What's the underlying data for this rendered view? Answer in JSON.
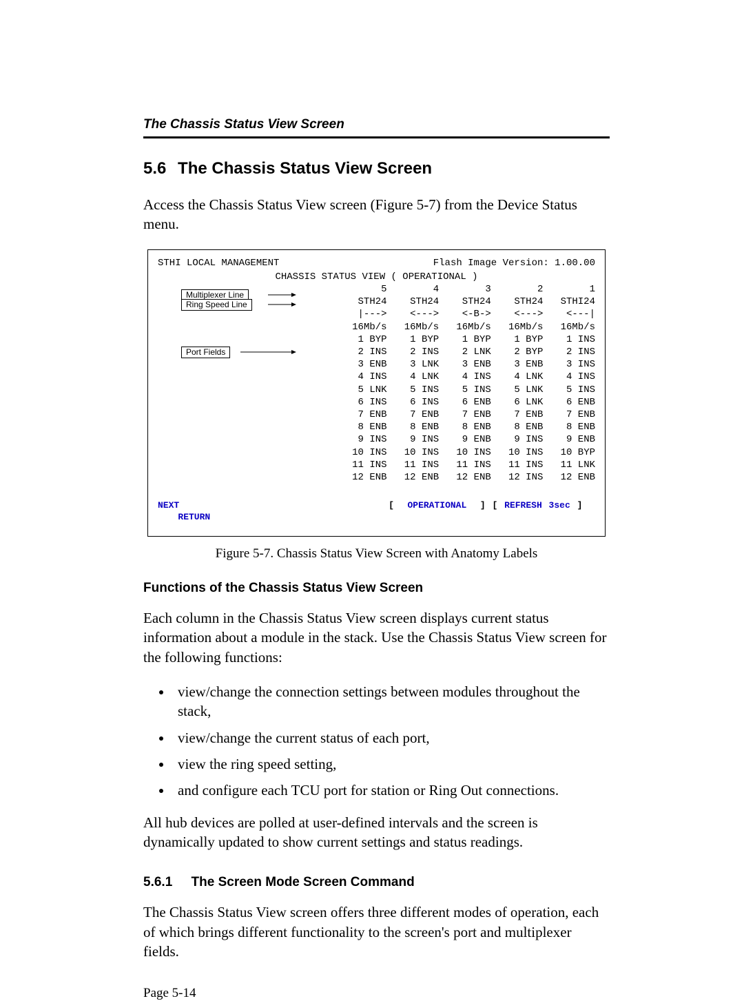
{
  "running_head": "The Chassis Status View Screen",
  "section_num": "5.6",
  "section_title": "The Chassis Status View Screen",
  "intro_para": "Access the Chassis Status View screen (Figure 5-7) from the Device Status menu.",
  "terminal": {
    "header_left": "STHI LOCAL MANAGEMENT",
    "header_right": "Flash Image Version:  1.00.00",
    "subtitle": "CHASSIS STATUS VIEW (   OPERATIONAL   )",
    "col_nums": "5        4        3        2        1",
    "models": "STH24    STH24    STH24    STH24   STHI24",
    "mux": "|--->    <--->    <-B->    <--->    <---|",
    "speeds": "16Mb/s   16Mb/s   16Mb/s   16Mb/s   16Mb/s",
    "rows": [
      " 1 BYP    1 BYP    1 BYP    1 BYP    1 INS",
      " 2 INS    2 INS    2 LNK    2 BYP    2 INS",
      " 3 ENB    3 LNK    3 ENB    3 ENB    3 INS",
      " 4 INS    4 LNK    4 INS    4 LNK    4 INS",
      " 5 LNK    5 INS    5 INS    5 LNK    5 INS",
      " 6 INS    6 INS    6 ENB    6 LNK    6 ENB",
      " 7 ENB    7 ENB    7 ENB    7 ENB    7 ENB",
      " 8 ENB    8 ENB    8 ENB    8 ENB    8 ENB",
      " 9 INS    9 INS    9 ENB    9 INS    9 ENB",
      "10 INS   10 INS   10 INS   10 INS   10 BYP",
      "11 INS   11 INS   11 INS   11 INS   11 LNK",
      "12 ENB   12 ENB   12 ENB   12 INS   12 ENB"
    ],
    "footer": {
      "next": "NEXT",
      "operational": "OPERATIONAL",
      "refresh": "REFRESH 3sec",
      "ret": "RETURN"
    },
    "callouts": {
      "mux": "Multiplexer Line",
      "speed": "Ring Speed Line",
      "port": "Port Fields"
    }
  },
  "fig_caption": "Figure 5-7.  Chassis Status View Screen with Anatomy Labels",
  "functions_heading": "Functions of the Chassis Status View Screen",
  "functions_para": "Each column in the Chassis Status View screen displays current status information about a module in the stack. Use the Chassis Status View screen for the following functions:",
  "bullets": [
    "view/change the connection settings between modules throughout the stack,",
    "view/change the current status of each port,",
    "view the ring speed setting,",
    "and configure each TCU port for station or Ring Out connections."
  ],
  "poll_para": "All hub devices are polled at user-defined intervals and the screen is dynamically updated to show current settings and status readings.",
  "subsection_num": "5.6.1",
  "subsection_title": "The Screen Mode Screen Command",
  "subsection_para": "The Chassis Status View screen offers three different modes of operation, each of which brings different functionality to the screen's port and multiplexer fields.",
  "page_num": "Page 5-14"
}
